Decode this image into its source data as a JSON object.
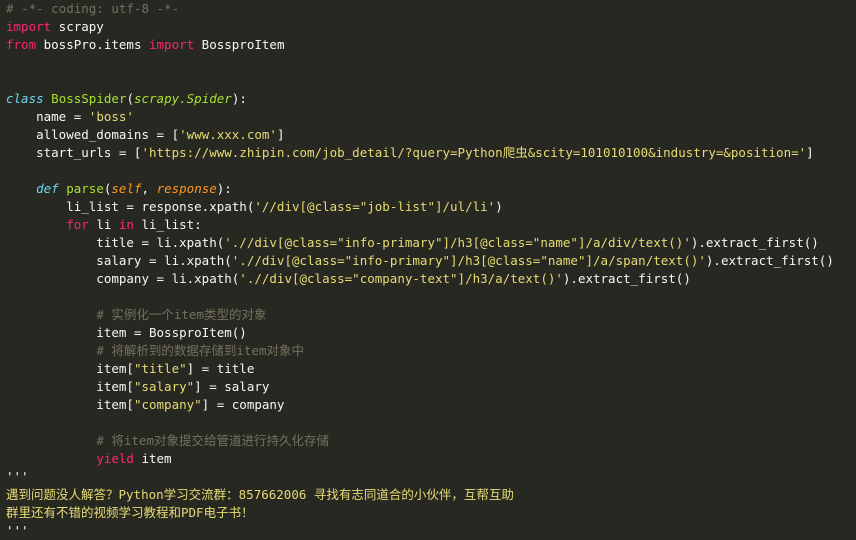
{
  "editor": {
    "colors": {
      "background": "#272822",
      "text": "#f8f8f2",
      "keyword": "#f92672",
      "definition": "#66d9ef",
      "name": "#a6e22e",
      "string": "#e6db74",
      "comment": "#75715e",
      "parameter": "#fd971f"
    },
    "lines": [
      [
        {
          "t": "com",
          "v": "# -*- coding: utf-8 -*-"
        }
      ],
      [
        {
          "t": "kw",
          "v": "import"
        },
        {
          "t": "txt",
          "v": " scrapy"
        }
      ],
      [
        {
          "t": "kw",
          "v": "from"
        },
        {
          "t": "txt",
          "v": " bossPro.items "
        },
        {
          "t": "kw",
          "v": "import"
        },
        {
          "t": "txt",
          "v": " BossproItem"
        }
      ],
      [],
      [],
      [
        {
          "t": "def",
          "v": "class"
        },
        {
          "t": "txt",
          "v": " "
        },
        {
          "t": "cls",
          "v": "BossSpider"
        },
        {
          "t": "txt",
          "v": "("
        },
        {
          "t": "inh",
          "v": "scrapy.Spider"
        },
        {
          "t": "txt",
          "v": "):"
        }
      ],
      [
        {
          "t": "txt",
          "v": "    name = "
        },
        {
          "t": "str",
          "v": "'boss'"
        }
      ],
      [
        {
          "t": "txt",
          "v": "    allowed_domains = ["
        },
        {
          "t": "str",
          "v": "'www.xxx.com'"
        },
        {
          "t": "txt",
          "v": "]"
        }
      ],
      [
        {
          "t": "txt",
          "v": "    start_urls = ["
        },
        {
          "t": "str",
          "v": "'https://www.zhipin.com/job_detail/?query=Python爬虫&scity=101010100&industry=&position='"
        },
        {
          "t": "txt",
          "v": "]"
        }
      ],
      [],
      [
        {
          "t": "txt",
          "v": "    "
        },
        {
          "t": "def",
          "v": "def"
        },
        {
          "t": "txt",
          "v": " "
        },
        {
          "t": "fn",
          "v": "parse"
        },
        {
          "t": "txt",
          "v": "("
        },
        {
          "t": "param",
          "v": "self"
        },
        {
          "t": "txt",
          "v": ", "
        },
        {
          "t": "param",
          "v": "response"
        },
        {
          "t": "txt",
          "v": "):"
        }
      ],
      [
        {
          "t": "txt",
          "v": "        li_list = response.xpath("
        },
        {
          "t": "str",
          "v": "'//div[@class=\"job-list\"]/ul/li'"
        },
        {
          "t": "txt",
          "v": ")"
        }
      ],
      [
        {
          "t": "txt",
          "v": "        "
        },
        {
          "t": "kw",
          "v": "for"
        },
        {
          "t": "txt",
          "v": " li "
        },
        {
          "t": "kw",
          "v": "in"
        },
        {
          "t": "txt",
          "v": " li_list:"
        }
      ],
      [
        {
          "t": "txt",
          "v": "            title = li.xpath("
        },
        {
          "t": "str",
          "v": "'.//div[@class=\"info-primary\"]/h3[@class=\"name\"]/a/div/text()'"
        },
        {
          "t": "txt",
          "v": ").extract_first()"
        }
      ],
      [
        {
          "t": "txt",
          "v": "            salary = li.xpath("
        },
        {
          "t": "str",
          "v": "'.//div[@class=\"info-primary\"]/h3[@class=\"name\"]/a/span/text()'"
        },
        {
          "t": "txt",
          "v": ").extract_first()"
        }
      ],
      [
        {
          "t": "txt",
          "v": "            company = li.xpath("
        },
        {
          "t": "str",
          "v": "'.//div[@class=\"company-text\"]/h3/a/text()'"
        },
        {
          "t": "txt",
          "v": ").extract_first()"
        }
      ],
      [],
      [
        {
          "t": "txt",
          "v": "            "
        },
        {
          "t": "com",
          "v": "# 实例化一个item类型的对象"
        }
      ],
      [
        {
          "t": "txt",
          "v": "            item = BossproItem()"
        }
      ],
      [
        {
          "t": "txt",
          "v": "            "
        },
        {
          "t": "com",
          "v": "# 将解析到的数据存储到item对象中"
        }
      ],
      [
        {
          "t": "txt",
          "v": "            item["
        },
        {
          "t": "str",
          "v": "\"title\""
        },
        {
          "t": "txt",
          "v": "] = title"
        }
      ],
      [
        {
          "t": "txt",
          "v": "            item["
        },
        {
          "t": "str",
          "v": "\"salary\""
        },
        {
          "t": "txt",
          "v": "] = salary"
        }
      ],
      [
        {
          "t": "txt",
          "v": "            item["
        },
        {
          "t": "str",
          "v": "\"company\""
        },
        {
          "t": "txt",
          "v": "] = company"
        }
      ],
      [],
      [
        {
          "t": "txt",
          "v": "            "
        },
        {
          "t": "com",
          "v": "# 将item对象提交给管道进行持久化存储"
        }
      ],
      [
        {
          "t": "txt",
          "v": "            "
        },
        {
          "t": "kw",
          "v": "yield"
        },
        {
          "t": "txt",
          "v": " item"
        }
      ],
      [
        {
          "t": "plain",
          "v": "'''"
        }
      ],
      [
        {
          "t": "note",
          "v": "遇到问题没人解答？Python学习交流群：857662006 寻找有志同道合的小伙伴，互帮互助"
        }
      ],
      [
        {
          "t": "note",
          "v": "群里还有不错的视频学习教程和PDF电子书！"
        }
      ],
      [
        {
          "t": "plain",
          "v": "'''"
        }
      ]
    ]
  }
}
